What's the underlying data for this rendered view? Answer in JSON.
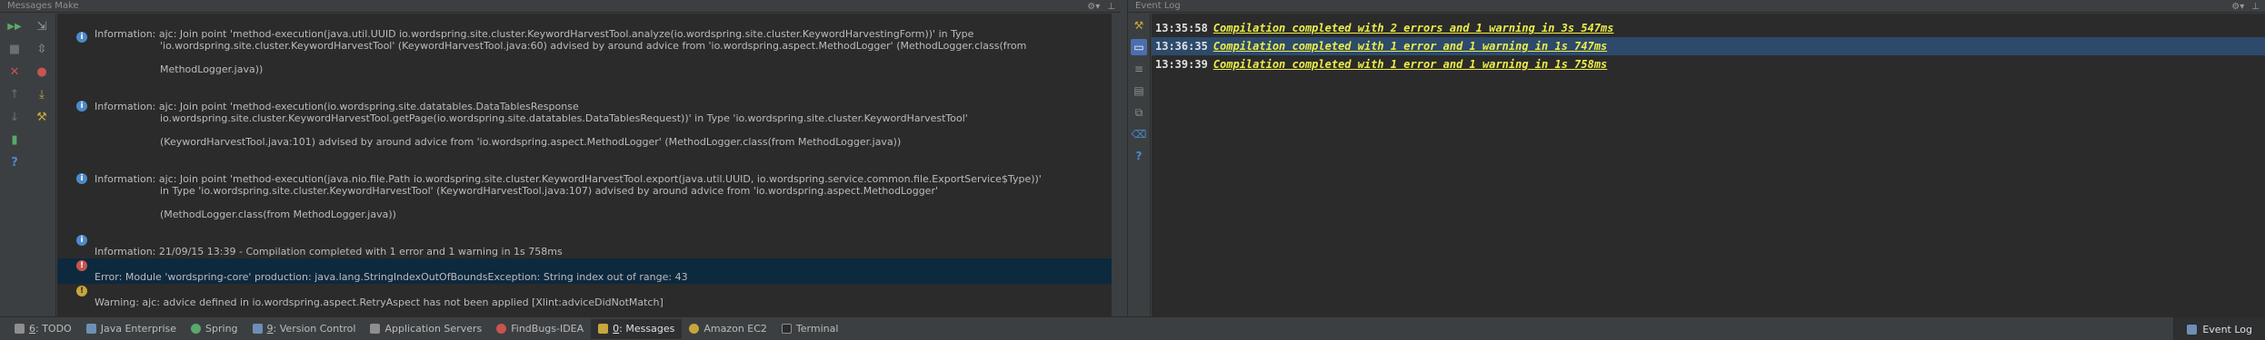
{
  "left_panel": {
    "title": "Messages Make",
    "header_tools": [
      "gear-icon",
      "hide-icon"
    ],
    "toolbar": [
      {
        "name": "rerun-icon",
        "glyph": "▶▶",
        "color": "#59a869"
      },
      {
        "name": "expand-all-icon",
        "glyph": "⇲",
        "color": "#9a9a9a"
      },
      {
        "name": "stop-icon",
        "glyph": "■",
        "color": "#6e6e6e"
      },
      {
        "name": "collapse-all-icon",
        "glyph": "⇳",
        "color": "#9a9a9a"
      },
      {
        "name": "close-icon",
        "glyph": "✕",
        "color": "#c75450"
      },
      {
        "name": "error-filter-icon",
        "glyph": "●",
        "color": "#c75450"
      },
      {
        "name": "up-icon",
        "glyph": "↑",
        "color": "#6e6e6e"
      },
      {
        "name": "export-icon",
        "glyph": "⤓",
        "color": "#c7a63b"
      },
      {
        "name": "down-icon",
        "glyph": "↓",
        "color": "#6e6e6e"
      },
      {
        "name": "settings-icon",
        "glyph": "⚒",
        "color": "#c7a63b"
      },
      {
        "name": "autoscroll-icon",
        "glyph": "▮",
        "color": "#59a869"
      },
      {
        "name": "help-icon",
        "glyph": "?",
        "color": "#4d8ac9"
      }
    ],
    "messages": [
      {
        "type": "info",
        "line1": "Information: ajc: Join point 'method-execution(java.util.UUID io.wordspring.site.cluster.KeywordHarvestTool.analyze(io.wordspring.site.cluster.KeywordHarvestingForm))' in Type",
        "line2": "'io.wordspring.site.cluster.KeywordHarvestTool' (KeywordHarvestTool.java:60) advised by around advice from 'io.wordspring.aspect.MethodLogger' (MethodLogger.class(from",
        "line3": "MethodLogger.java))"
      },
      {
        "type": "info",
        "line1": "Information: ajc: Join point 'method-execution(io.wordspring.site.datatables.DataTablesResponse",
        "line2": "io.wordspring.site.cluster.KeywordHarvestTool.getPage(io.wordspring.site.datatables.DataTablesRequest))' in Type 'io.wordspring.site.cluster.KeywordHarvestTool'",
        "line3": "(KeywordHarvestTool.java:101) advised by around advice from 'io.wordspring.aspect.MethodLogger' (MethodLogger.class(from MethodLogger.java))"
      },
      {
        "type": "info",
        "line1": "Information: ajc: Join point 'method-execution(java.nio.file.Path io.wordspring.site.cluster.KeywordHarvestTool.export(java.util.UUID, io.wordspring.service.common.file.ExportService$Type))'",
        "line2": "in Type 'io.wordspring.site.cluster.KeywordHarvestTool' (KeywordHarvestTool.java:107) advised by around advice from 'io.wordspring.aspect.MethodLogger'",
        "line3": "(MethodLogger.class(from MethodLogger.java))"
      },
      {
        "type": "info",
        "line1": "Information: 21/09/15 13:39 - Compilation completed with 1 error and 1 warning in 1s 758ms",
        "line2": "",
        "line3": ""
      },
      {
        "type": "err",
        "line1": "Error: Module 'wordspring-core' production: java.lang.StringIndexOutOfBoundsException: String index out of range: 43",
        "line2": "",
        "line3": ""
      },
      {
        "type": "warn",
        "line1": "Warning: ajc: advice defined in io.wordspring.aspect.RetryAspect has not been applied [Xlint:adviceDidNotMatch]",
        "line2": "",
        "line3": ""
      }
    ]
  },
  "right_panel": {
    "title": "Event Log",
    "header_tools": [
      "gear-icon",
      "hide-icon"
    ],
    "toolbar": [
      {
        "name": "settings-icon",
        "glyph": "⚒"
      },
      {
        "name": "mark-read-icon",
        "glyph": "▭"
      },
      {
        "name": "filter-icon",
        "glyph": "≡"
      },
      {
        "name": "print-icon",
        "glyph": "▤"
      },
      {
        "name": "copy-icon",
        "glyph": "⧉"
      },
      {
        "name": "clear-icon",
        "glyph": "⌫"
      },
      {
        "name": "help-icon",
        "glyph": "?"
      }
    ],
    "events": [
      {
        "time": "13:35:58",
        "text": "Compilation completed with 2 errors and 1 warning in 3s 547ms"
      },
      {
        "time": "13:36:35",
        "text": "Compilation completed with 1 error and 1 warning in 1s 747ms"
      },
      {
        "time": "13:39:39",
        "text": "Compilation completed with 1 error and 1 warning in 1s 758ms"
      }
    ]
  },
  "bottom_bar": {
    "tabs": [
      {
        "num": "6",
        "label": ": TODO",
        "color": "#8e8e8e",
        "active": false
      },
      {
        "num": "",
        "label": "Java Enterprise",
        "color": "#6e8fb5",
        "active": false
      },
      {
        "num": "",
        "label": "Spring",
        "color": "#59a869",
        "active": false
      },
      {
        "num": "9",
        "label": ": Version Control",
        "color": "#6e8fb5",
        "active": false
      },
      {
        "num": "",
        "label": "Application Servers",
        "color": "#8e8e8e",
        "active": false
      },
      {
        "num": "",
        "label": "FindBugs-IDEA",
        "color": "#c75450",
        "active": false
      },
      {
        "num": "0",
        "label": ": Messages",
        "color": "#c7a63b",
        "active": true
      },
      {
        "num": "",
        "label": "Amazon EC2",
        "color": "#c7a63b",
        "active": false
      },
      {
        "num": "",
        "label": "Terminal",
        "color": "#8e8e8e",
        "active": false
      }
    ],
    "event_log_label": "Event Log"
  }
}
